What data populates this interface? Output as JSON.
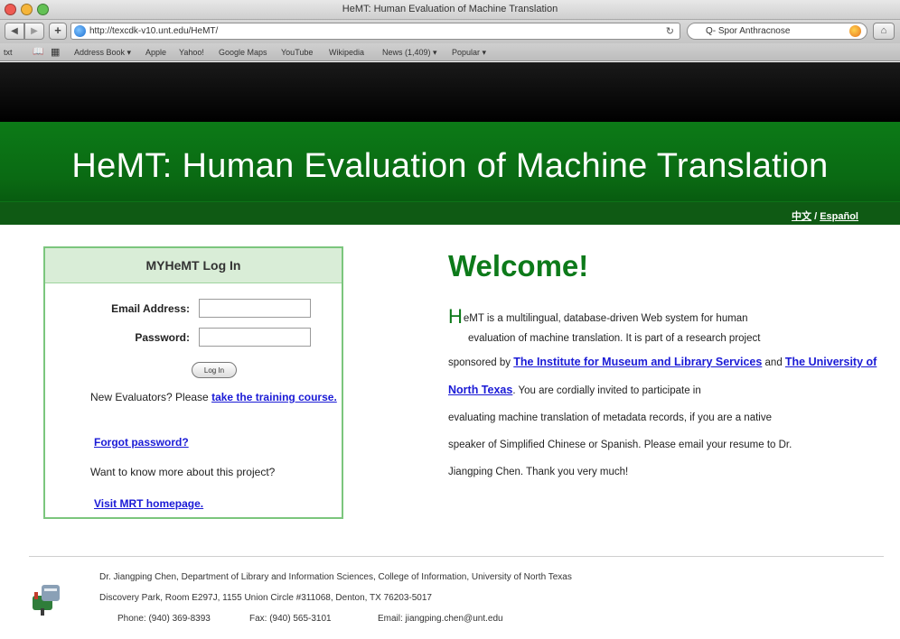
{
  "window": {
    "title": "HeMT: Human Evaluation of Machine Translation"
  },
  "toolbar": {
    "back_label": "◀",
    "forward_label": "▶",
    "add_label": "+",
    "url": "http://texcdk-v10.unt.edu/HeMT/",
    "reload_glyph": "↻",
    "search_value": "Q- Spor Anthracnose"
  },
  "bookmarks": [
    "Address Book ▾",
    "Apple",
    "Yahoo!",
    "Google Maps",
    "YouTube",
    "Wikipedia",
    "News (1,409) ▾",
    "Popular ▾"
  ],
  "bookmarks_prefix": "txt",
  "banner": {
    "title": "HeMT: Human Evaluation of Machine Translation",
    "lang_chinese": "中文",
    "lang_separator": " / ",
    "lang_spanish": "Español"
  },
  "login": {
    "heading": "MYHeMT Log In",
    "email_label": "Email Address:",
    "email_value": "",
    "password_label": "Password:",
    "password_value": "",
    "button_label": "Log In",
    "new_evaluators_text": "New Evaluators? Please ",
    "training_link": "take the training course.",
    "forgot_link": "Forgot password?",
    "more_text": "Want to know more about this project?",
    "homepage_link": "Visit MRT homepage."
  },
  "welcome": {
    "title": "Welcome!",
    "drop_cap": "H",
    "line1": "eMT is a multilingual, database-driven Web system for human",
    "line2": "evaluation of machine translation. It is part of a research project",
    "line3_pre": "sponsored by ",
    "imls_link": "The Institute for Museum and Library Services",
    "line3_mid": " and ",
    "unt_link": "The University of North Texas",
    "line4_post": ". You are cordially invited to participate in",
    "line5": "evaluating machine translation of metadata records, if you are a native",
    "line6": "speaker of Simplified Chinese or Spanish. Please email your resume to Dr.",
    "line7": "Jiangping Chen. Thank you very much!"
  },
  "footer": {
    "line1": "Dr. Jiangping Chen, Department of Library and Information Sciences, College of Information, University of North Texas",
    "line2": "Discovery Park, Room E297J, 1155 Union Circle #311068, Denton, TX 76203-5017",
    "phone": "Phone: (940) 369-8393",
    "fax": "Fax: (940) 565-3101",
    "email": "Email: jiangping.chen@unt.edu"
  },
  "colors": {
    "banner_green": "#0a6a13",
    "welcome_green": "#0d7a1a",
    "link_blue": "#1a1ad6",
    "panel_border": "#7bc67d"
  }
}
